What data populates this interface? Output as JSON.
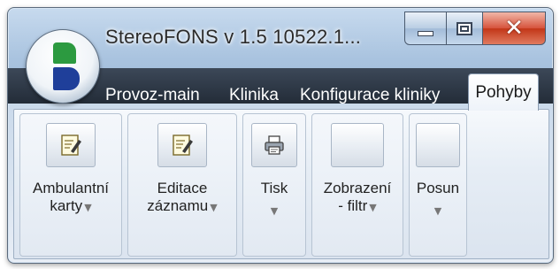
{
  "window": {
    "title": "StereoFONS v 1.5 10522.1..."
  },
  "caption_buttons": {
    "minimize": "minimize-icon",
    "maximize": "maximize-icon",
    "close": "close-icon",
    "close_glyph": "✕"
  },
  "app_menu": {
    "icon": "app-logo-icon",
    "colors": {
      "green": "#2c9a40",
      "blue": "#1f3f9a"
    }
  },
  "tabs": [
    {
      "label": "Provoz-main",
      "active": false
    },
    {
      "label": "Klinika",
      "active": false
    },
    {
      "label": "Konfigurace kliniky",
      "active": false
    },
    {
      "label": "Pohyby",
      "active": true
    }
  ],
  "ribbon": {
    "buttons": [
      {
        "line1": "Ambulantní",
        "line2": "karty",
        "has_dropdown": true,
        "icon": "edit-document-icon"
      },
      {
        "line1": "Editace",
        "line2": "záznamu",
        "has_dropdown": true,
        "icon": "edit-document-icon"
      },
      {
        "line1": "Tisk",
        "line2": "",
        "has_dropdown": true,
        "icon": "printer-icon"
      },
      {
        "line1": "Zobrazení",
        "line2": "- filtr",
        "has_dropdown": true,
        "icon": "blank-icon"
      },
      {
        "line1": "Posun",
        "line2": "",
        "has_dropdown": true,
        "icon": "blank-icon"
      }
    ],
    "dropdown_glyph": "▼"
  }
}
